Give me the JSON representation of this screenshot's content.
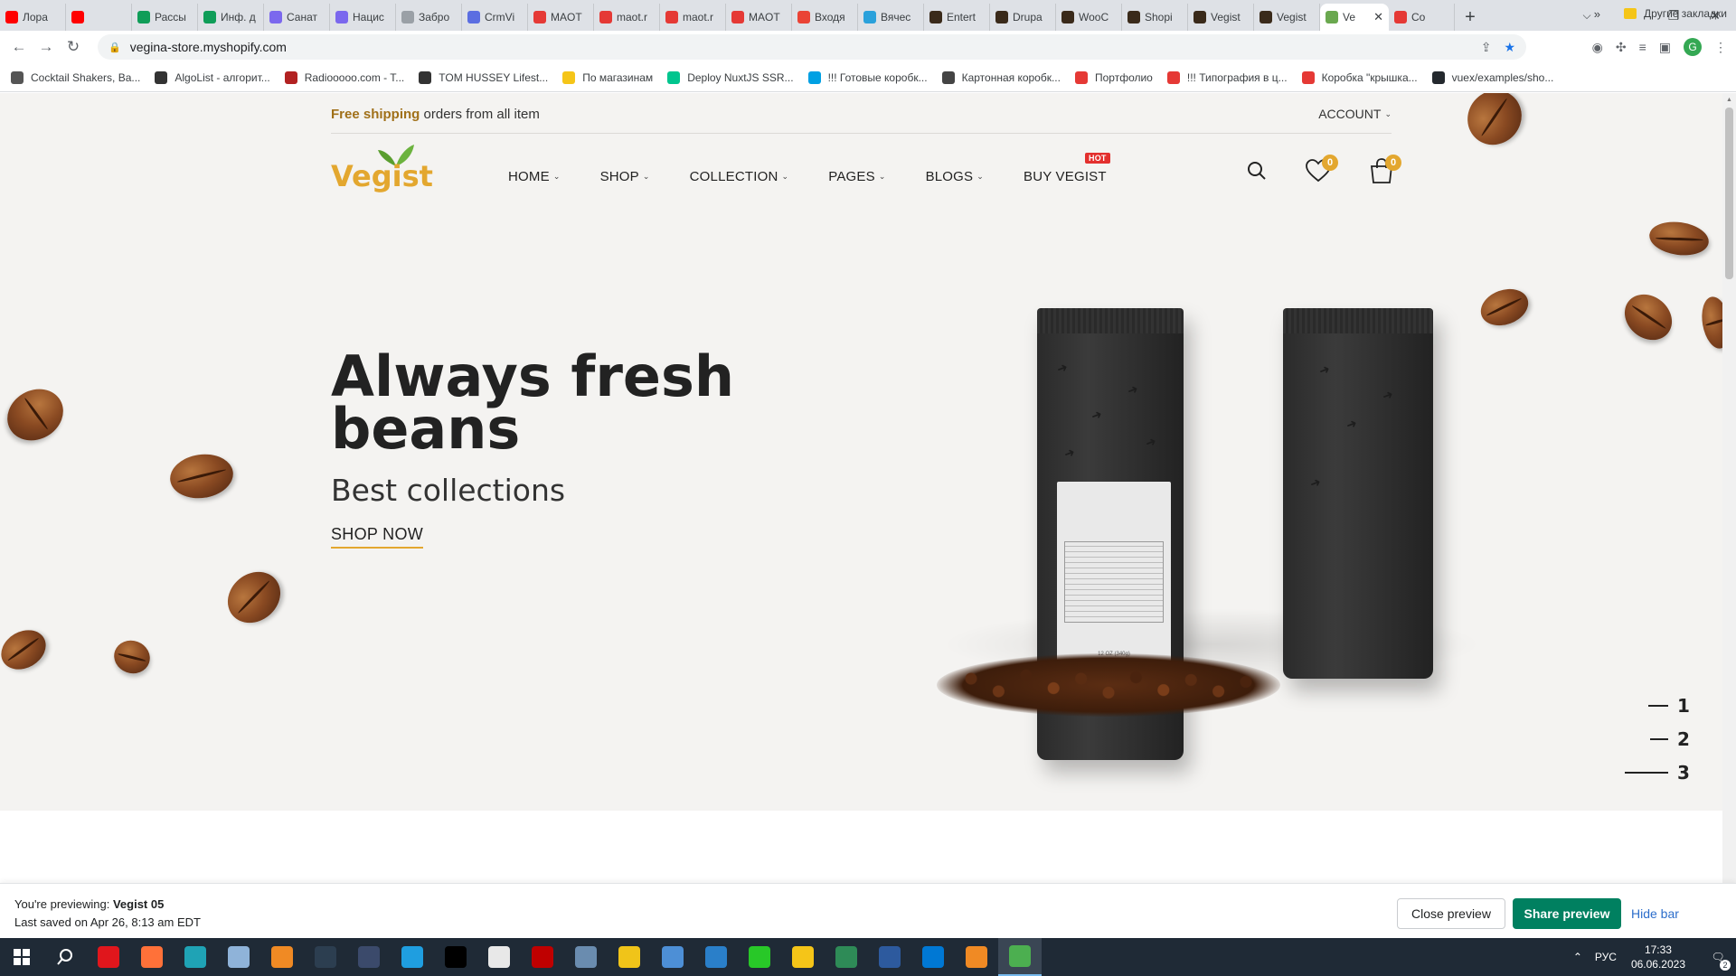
{
  "browser": {
    "tabs": [
      {
        "title": "Лора",
        "color": "#ff0000"
      },
      {
        "title": "",
        "color": "#ff0000"
      },
      {
        "title": "Рассы",
        "color": "#0f9d58"
      },
      {
        "title": "Инф. д",
        "color": "#0f9d58"
      },
      {
        "title": "Санат",
        "color": "#7b68ee"
      },
      {
        "title": "Нацис",
        "color": "#7b68ee"
      },
      {
        "title": "Забро",
        "color": "#9aa0a6"
      },
      {
        "title": "CrmVi",
        "color": "#5b6ee1"
      },
      {
        "title": "MAOT",
        "color": "#e53935"
      },
      {
        "title": "maot.r",
        "color": "#e53935"
      },
      {
        "title": "maot.r",
        "color": "#e53935"
      },
      {
        "title": "MAOT",
        "color": "#e53935"
      },
      {
        "title": "Входя",
        "color": "#ea4335"
      },
      {
        "title": "Вячес",
        "color": "#2aa1db"
      },
      {
        "title": "Entert",
        "color": "#3a2a1a"
      },
      {
        "title": "Drupa",
        "color": "#3a2a1a"
      },
      {
        "title": "WooC",
        "color": "#3a2a1a"
      },
      {
        "title": "Shopi",
        "color": "#3a2a1a"
      },
      {
        "title": "Vegist",
        "color": "#3a2a1a"
      },
      {
        "title": "Vegist",
        "color": "#3a2a1a"
      },
      {
        "title": "Ve",
        "color": "#6aa84f",
        "active": true
      },
      {
        "title": "Co",
        "color": "#e53935"
      }
    ],
    "url": "vegina-store.myshopify.com",
    "bookmarks": [
      {
        "label": "Cocktail Shakers, Ba...",
        "color": "#555555"
      },
      {
        "label": "AlgoList - алгорит...",
        "color": "#333333"
      },
      {
        "label": "Radiooooo.com - T...",
        "color": "#b22222"
      },
      {
        "label": "TOM HUSSEY Lifest...",
        "color": "#333333"
      },
      {
        "label": "По магазинам",
        "color": "#f5c518"
      },
      {
        "label": "Deploy NuxtJS SSR...",
        "color": "#00c58e"
      },
      {
        "label": "!!! Готовые коробк...",
        "color": "#00a0e3"
      },
      {
        "label": "Картонная коробк...",
        "color": "#444444"
      },
      {
        "label": "Портфолио",
        "color": "#e53935"
      },
      {
        "label": "!!! Типография в ц...",
        "color": "#e53935"
      },
      {
        "label": "Коробка \"крышка...",
        "color": "#e53935"
      },
      {
        "label": "vuex/examples/sho...",
        "color": "#24292e"
      }
    ],
    "bookmarks_more": "»",
    "other_bookmarks": "Другие закладки",
    "profile_initial": "G"
  },
  "store": {
    "topbar": {
      "free_shipping": "Free shipping",
      "shipping_rest": " orders from all item",
      "account": "ACCOUNT"
    },
    "logo_text": "Vegist",
    "nav": {
      "home": "HOME",
      "shop": "SHOP",
      "collection": "COLLECTION",
      "pages": "PAGES",
      "blogs": "BLOGS",
      "buy": "BUY VEGIST",
      "hot_badge": "HOT"
    },
    "wishlist_count": "0",
    "cart_count": "0",
    "hero": {
      "headline": "Always fresh beans",
      "subheadline": "Best collections",
      "cta": "SHOP NOW"
    },
    "slides": [
      "1",
      "2",
      "3"
    ],
    "active_slide": "3",
    "bag_label_small": "12 OZ (340g)"
  },
  "preview_bar": {
    "prefix": "You're previewing: ",
    "theme": "Vegist 05",
    "saved": "Last saved on Apr 26, 8:13 am EDT",
    "close": "Close preview",
    "share": "Share preview",
    "hide": "Hide bar"
  },
  "taskbar": {
    "lang": "РУС",
    "time": "17:33",
    "date": "06.06.2023",
    "notifications": "2",
    "apps": [
      {
        "name": "opera",
        "color": "#e0161c"
      },
      {
        "name": "firefox",
        "color": "#ff7139"
      },
      {
        "name": "app-teal",
        "color": "#1fa3b5"
      },
      {
        "name": "app-notes",
        "color": "#8fb3d9"
      },
      {
        "name": "app-headphones",
        "color": "#f08a24"
      },
      {
        "name": "hs",
        "color": "#2c3e50"
      },
      {
        "name": "app-disk",
        "color": "#3b4a6b"
      },
      {
        "name": "edge",
        "color": "#1f9ee0"
      },
      {
        "name": "terminal",
        "color": "#000000"
      },
      {
        "name": "code-app",
        "color": "#e8e8e8"
      },
      {
        "name": "filezilla",
        "color": "#bf0000"
      },
      {
        "name": "calculator",
        "color": "#6a8caf"
      },
      {
        "name": "color-app",
        "color": "#f0c419"
      },
      {
        "name": "network",
        "color": "#4d8fd6"
      },
      {
        "name": "photos",
        "color": "#2a7fc9"
      },
      {
        "name": "icq",
        "color": "#28c828"
      },
      {
        "name": "explorer",
        "color": "#f5c518"
      },
      {
        "name": "sheets",
        "color": "#2e8b57"
      },
      {
        "name": "powershell",
        "color": "#2d5a9e"
      },
      {
        "name": "vscode",
        "color": "#0078d4"
      },
      {
        "name": "sublime",
        "color": "#f08a24"
      },
      {
        "name": "chrome",
        "color": "#4caf50",
        "active": true
      }
    ]
  },
  "colors": {
    "accent": "#e3a72f",
    "hot": "#e3302e",
    "share": "#008060",
    "link": "#2c6ecb"
  }
}
